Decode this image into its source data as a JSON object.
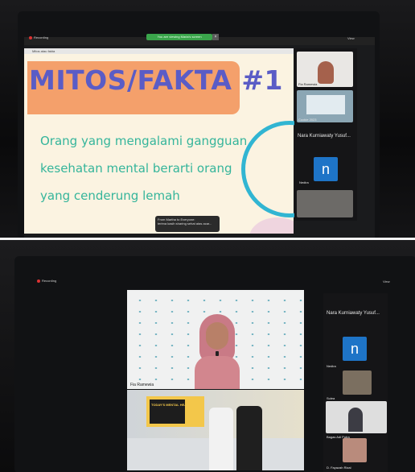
{
  "photo1": {
    "recording": "Recording",
    "view_label": "View",
    "speaking_banner": "You are viewing Maria's screen",
    "tab_title": "Mitos atau fakta",
    "slide": {
      "title": "MITOS/FAKTA #1",
      "lines": [
        "Orang yang mengalami gangguan",
        "kesehatan mental berarti orang",
        "yang cenderung lemah"
      ]
    },
    "chat_popup": {
      "from": "From Martha to Everyone:",
      "message": "terima kasih sharing sehat atas acar..."
    },
    "participants": [
      {
        "label": "Fia Ramewia"
      },
      {
        "label": "Cookie 2023"
      },
      {
        "label": "Nara Kurniawaty Yusuf..."
      },
      {
        "label": "Nedira",
        "avatar": "n"
      }
    ]
  },
  "photo2": {
    "recording": "Recording",
    "view_label": "View",
    "speaker_label": "Fia Ramewia",
    "participants": [
      {
        "label": "Nara Kurniawaty Yusuf..."
      },
      {
        "label": "Nedira",
        "avatar": "n"
      },
      {
        "label": "Sulea"
      },
      {
        "label": "Bagas Adi Putra"
      },
      {
        "label": "D. Fayazah Rizal"
      }
    ],
    "banner_title": "TODAY'S MENTAL HEALTH"
  },
  "colors": {
    "slide_bg": "#fbf3e1",
    "title_block": "#f4a06b",
    "title_text": "#5a5cc6",
    "body_text": "#35b59b",
    "accent_ring": "#31b5d2",
    "speaking_bar": "#3aa54b",
    "avatar_blue": "#1e74c7"
  }
}
